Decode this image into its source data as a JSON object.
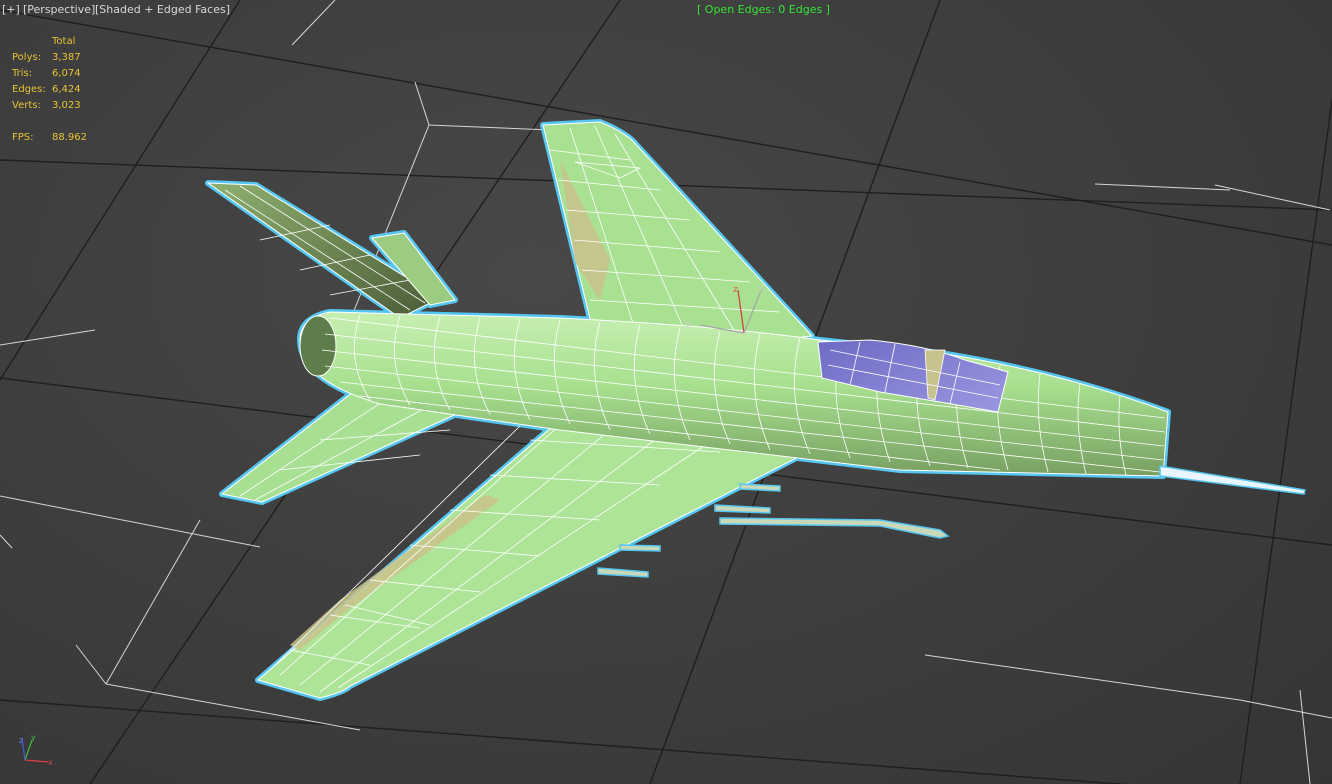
{
  "viewport": {
    "menu_label": "[+]",
    "view_label": "[Perspective]",
    "shading_label": "[Shaded + Edged Faces]",
    "open_edges": "[ Open Edges: 0 Edges ]"
  },
  "stats": {
    "header": "Total",
    "rows": [
      {
        "label": "Polys:",
        "value": "3,387"
      },
      {
        "label": "Tris:",
        "value": "6,074"
      },
      {
        "label": "Edges:",
        "value": "6,424"
      },
      {
        "label": "Verts:",
        "value": "3,023"
      }
    ],
    "fps_label": "FPS:",
    "fps_value": "88.962"
  },
  "gizmo": {
    "x": "x",
    "y": "y",
    "z": "z"
  },
  "colors": {
    "background": "#3c3c3c",
    "grid": "#1e1e1e",
    "overlay_text": "#d9d9d9",
    "open_edges_text": "#35e635",
    "stats_text": "#e8c235",
    "model_face": "#a6e08e",
    "model_shadow": "#56673f",
    "canopy": "#7a78cc",
    "wireframe": "#ffffff",
    "selection_outline": "#55c6f0"
  }
}
